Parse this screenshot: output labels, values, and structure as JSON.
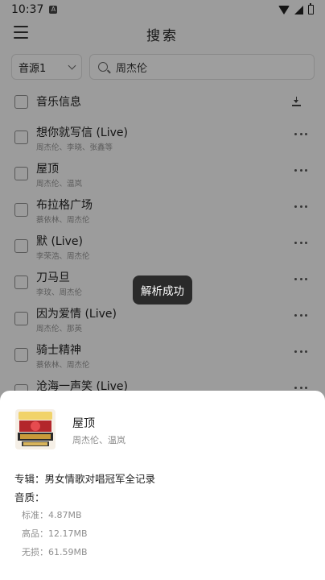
{
  "status_bar": {
    "time": "10:37",
    "notification_glyph": "A"
  },
  "header": {
    "title": "搜索"
  },
  "search": {
    "source_label": "音源1",
    "query": "周杰伦"
  },
  "list": {
    "header_label": "音乐信息",
    "items": [
      {
        "title": "想你就写信 (Live)",
        "artist": "周杰伦、李晓、张鑫等"
      },
      {
        "title": "屋顶",
        "artist": "周杰伦、温岚"
      },
      {
        "title": "布拉格广场",
        "artist": "蔡依林、周杰伦"
      },
      {
        "title": "默 (Live)",
        "artist": "李荣浩、周杰伦"
      },
      {
        "title": "刀马旦",
        "artist": "李玟、周杰伦"
      },
      {
        "title": "因为爱情 (Live)",
        "artist": "周杰伦、那英"
      },
      {
        "title": "骑士精神",
        "artist": "蔡依林、周杰伦"
      },
      {
        "title": "沧海一声笑 (Live)",
        "artist": ""
      }
    ]
  },
  "toast": {
    "message": "解析成功"
  },
  "sheet": {
    "title": "屋顶",
    "artist": "周杰伦、温岚",
    "album_line": "专辑：男女情歌对唱冠军全记录",
    "quality_label": "音质：",
    "qualities": [
      {
        "text": "标准：4.87MB"
      },
      {
        "text": "高品：12.17MB"
      },
      {
        "text": "无损：61.59MB"
      }
    ]
  },
  "colors": {
    "toast_bg": "#2a2a2a",
    "dim_overlay": "rgba(0,0,0,0.36)",
    "sheet_bg": "#ffffff"
  },
  "icons": [
    "menu-icon",
    "search-icon",
    "chevron-down-icon",
    "download-icon",
    "more-icon",
    "wifi-icon",
    "signal-icon",
    "battery-icon"
  ]
}
